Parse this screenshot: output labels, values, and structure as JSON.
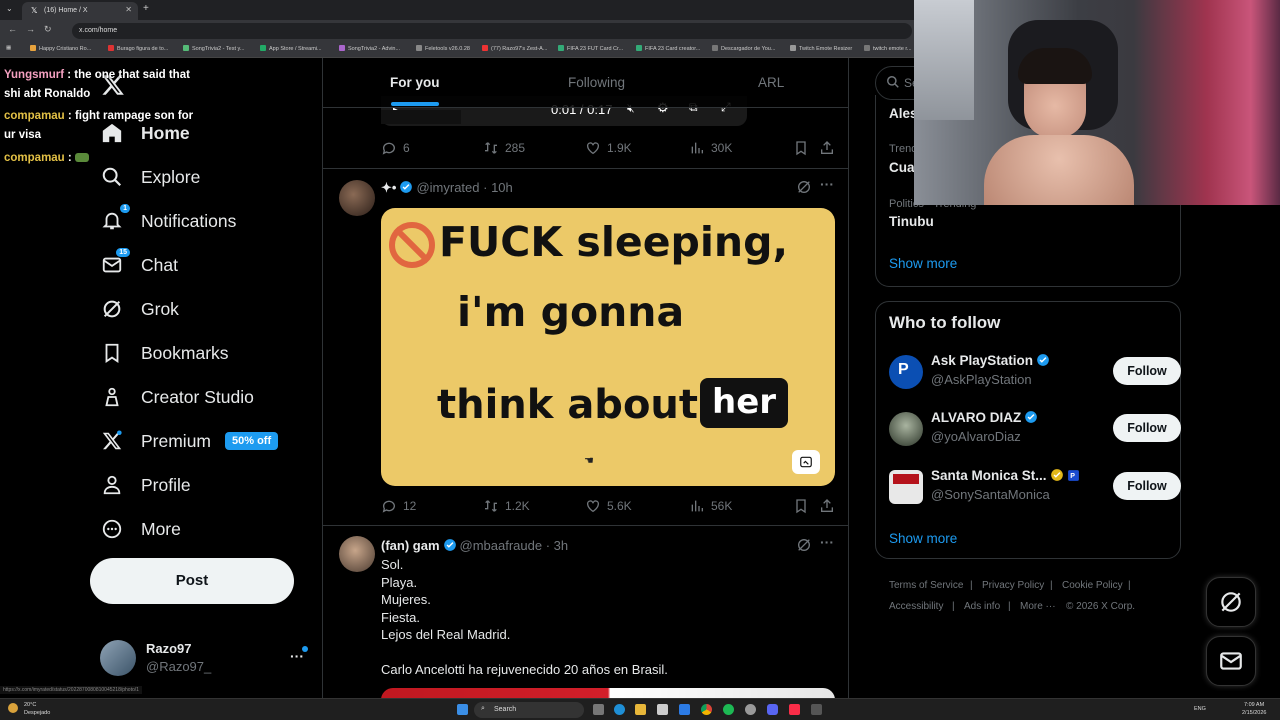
{
  "browser": {
    "tab_title": "(16) Home / X",
    "url": "x.com/home",
    "bookmarks": [
      "Happy Cristiano Ro...",
      "Burago figura de to...",
      "SongTrivia2 - Test y...",
      "App Store / Streami...",
      "SongTrivia2 - Advin...",
      "Feletools v26.0.28",
      "(77) Razo97's Zest-A...",
      "FIFA 23 FUT Card Cr...",
      "FIFA 23 Card creator...",
      "Descargador de You...",
      "Twitch Emote Resizer",
      "twitch emote r..."
    ],
    "status_url": "https://x.com/imyrated/status/2022870080810045218/photo/1"
  },
  "chat": [
    {
      "user": "Yungsmurf",
      "message": ": the one that said that",
      "cont": "shi abt Ronaldo",
      "color": "pink"
    },
    {
      "user": "compamau",
      "message": ": fight rampage son for",
      "cont": "ur visa",
      "color": "gold"
    },
    {
      "user": "compamau",
      "message": ":",
      "cont": "",
      "color": "gold"
    }
  ],
  "sidebar": {
    "items": [
      {
        "label": "Home",
        "icon": "home-icon",
        "bold": true
      },
      {
        "label": "Explore",
        "icon": "search-icon"
      },
      {
        "label": "Notifications",
        "icon": "bell-icon",
        "badge": "1"
      },
      {
        "label": "Chat",
        "icon": "mail-icon",
        "badge": "15"
      },
      {
        "label": "Grok",
        "icon": "grok-icon"
      },
      {
        "label": "Bookmarks",
        "icon": "bookmark-icon"
      },
      {
        "label": "Creator Studio",
        "icon": "creator-studio-icon"
      },
      {
        "label": "Premium",
        "icon": "x-logo-icon",
        "badge": "50% off"
      },
      {
        "label": "Profile",
        "icon": "person-icon"
      },
      {
        "label": "More",
        "icon": "more-circle-icon"
      }
    ],
    "post_label": "Post",
    "account": {
      "name": "Razo97",
      "handle": "@Razo97_"
    }
  },
  "feed": {
    "tabs": [
      "For you",
      "Following",
      "ARL"
    ],
    "active_tab": "For you",
    "video_time": "0:01 / 0:17",
    "tweet0_stats": {
      "replies": "6",
      "reposts": "285",
      "likes": "1.9K",
      "views": "30K"
    },
    "tweet1": {
      "name": "✦•",
      "handle": "@imyrated",
      "time": "10h",
      "meme_line1": "FUCK sleeping,",
      "meme_line2": "i'm gonna",
      "meme_line3": "think about",
      "meme_line4": "her",
      "stats": {
        "replies": "12",
        "reposts": "1.2K",
        "likes": "5.6K",
        "views": "56K"
      }
    },
    "tweet2": {
      "name": "(fan) gam",
      "handle": "@mbaafraude",
      "time": "3h",
      "lines": [
        "Sol.",
        "Playa.",
        "Mujeres.",
        "Fiesta.",
        "Lejos del Real Madrid.",
        "",
        "Carlo Ancelotti ha rejuvenecido 20 años en Brasil."
      ]
    }
  },
  "right": {
    "search_placeholder": "Se",
    "trends": [
      {
        "meta": "",
        "name": "Ales"
      },
      {
        "meta": "Trend",
        "name": "Cua"
      },
      {
        "meta": "Politics · Trending",
        "name": "Tinubu"
      }
    ],
    "show_more": "Show more",
    "who_to_follow_title": "Who to follow",
    "who_to_follow": [
      {
        "name": "Ask PlayStation",
        "handle": "@AskPlayStation",
        "button": "Follow"
      },
      {
        "name": "ALVARO DIAZ",
        "handle": "@yoAlvaroDiaz",
        "button": "Follow"
      },
      {
        "name": "Santa Monica St...",
        "handle": "@SonySantaMonica",
        "button": "Follow"
      }
    ],
    "show_more2": "Show more",
    "footer": [
      "Terms of Service",
      "Privacy Policy",
      "Cookie Policy",
      "Accessibility",
      "Ads info",
      "More ···",
      "© 2026 X Corp."
    ]
  },
  "taskbar": {
    "weather_temp": "20°C",
    "weather_desc": "Despejado",
    "search": "Search",
    "lang": "ENG",
    "time": "7:09 AM",
    "date": "2/15/2026"
  },
  "colors": {
    "accent": "#1d9bf0",
    "meme_bg": "#ecc968",
    "text": "#e7e9ea",
    "muted": "#71767b"
  }
}
